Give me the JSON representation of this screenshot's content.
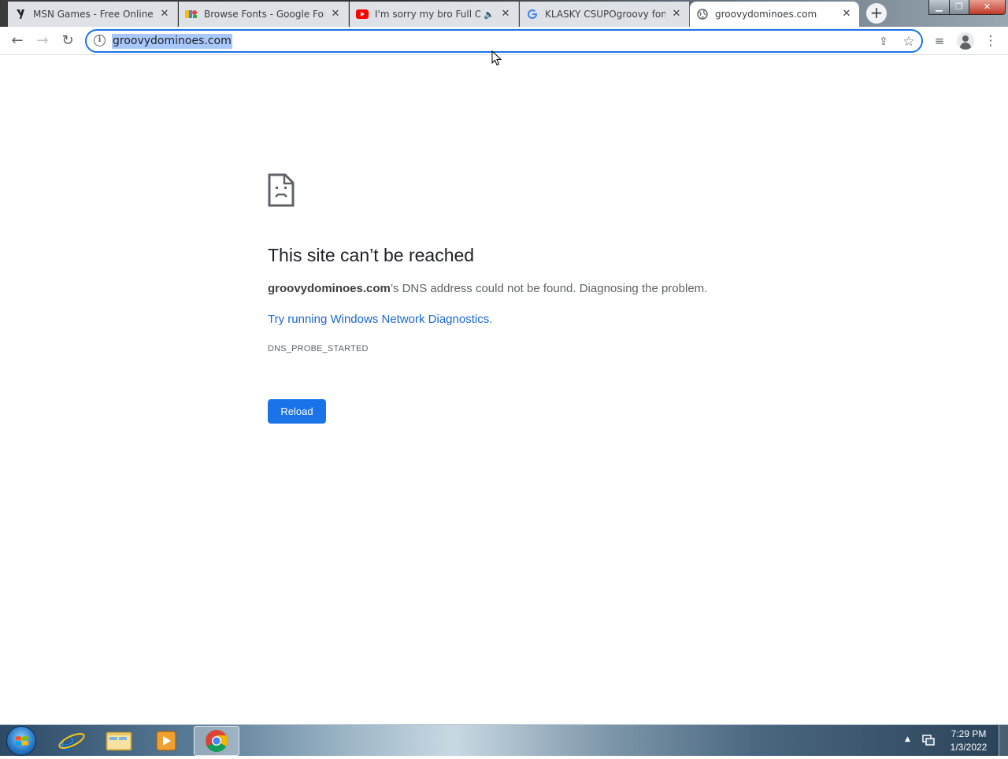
{
  "browser": {
    "tabs": [
      {
        "title": "MSN Games - Free Online G",
        "icon": "msn-games-icon"
      },
      {
        "title": "Browse Fonts - Google Fonts",
        "icon": "google-fonts-icon"
      },
      {
        "title": "I'm sorry my bro Full On",
        "icon": "youtube-icon",
        "audio": "🔈"
      },
      {
        "title": "KLASKY CSUPOgroovy font",
        "icon": "google-icon"
      },
      {
        "title": "groovydominoes.com",
        "icon": "globe-icon",
        "active": true
      }
    ],
    "tab_close_glyph": "✕",
    "new_tab_glyph": "+",
    "window_controls": {
      "minimize": "▁",
      "maximize": "❐",
      "close": "✕"
    },
    "toolbar": {
      "back_glyph": "←",
      "forward_glyph": "→",
      "reload_glyph": "↻",
      "info_glyph": "i",
      "url": "groovydominoes.com",
      "share_glyph": "⇪",
      "star_glyph": "☆",
      "media_glyph": "≡",
      "menu_glyph": "⋮"
    }
  },
  "error_page": {
    "title": "This site can’t be reached",
    "domain_bold": "groovydominoes.com",
    "message_rest": "’s DNS address could not be found. Diagnosing the problem.",
    "link_text": "Try running Windows Network Diagnostics",
    "link_suffix": ".",
    "error_code": "DNS_PROBE_STARTED",
    "reload_label": "Reload"
  },
  "taskbar": {
    "apps": [
      "internet-explorer-icon",
      "file-explorer-icon",
      "media-player-icon",
      "chrome-icon"
    ],
    "time": "7:29 PM",
    "date": "1/3/2022",
    "tray_arrow": "▲"
  },
  "colors": {
    "accent": "#1a73e8",
    "link": "#1967d2",
    "url_highlight": "#a8c7fa"
  }
}
